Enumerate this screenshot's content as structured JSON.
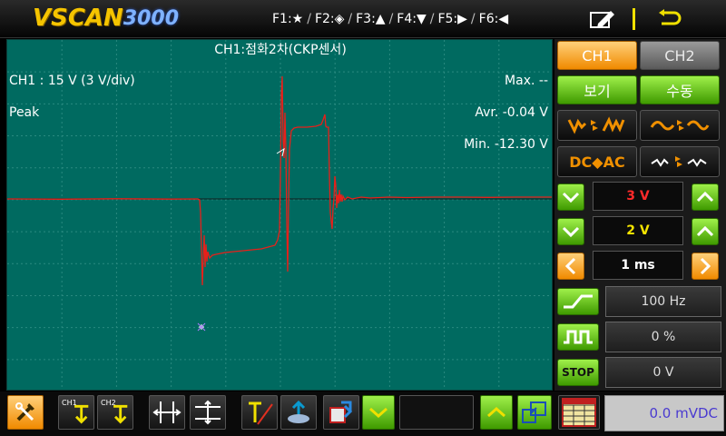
{
  "header": {
    "logo_part1": "VSCAN",
    "logo_part2": "3000",
    "fkeys": [
      "F1:★",
      "F2:◈",
      "F3:▲",
      "F4:▼",
      "F5:▶",
      "F6:◀"
    ]
  },
  "scope": {
    "title": "CH1:점화2차(CKP센서)",
    "scale_label": "CH1 : 15 V (3 V/div)",
    "mode_label": "Peak",
    "max_label": "Max. --",
    "avr_label": "Avr. -0.04 V",
    "min_label": "Min. -12.30 V",
    "trace_color": "#e8201a",
    "background_color": "#006a60"
  },
  "panel": {
    "ch1_label": "CH1",
    "ch2_label": "CH2",
    "view_label": "보기",
    "manual_label": "수동",
    "dc_ac_label": "DC◆AC",
    "volt_div_ch1": "3 V",
    "volt_div_ch2": "2 V",
    "time_div": "1 ms",
    "frequency": "100 Hz",
    "duty": "0 %",
    "stop_label": "STOP",
    "stop_value": "0 V"
  },
  "toolbar": {
    "ch1_label": "CH1",
    "ch2_label": "CH2",
    "readout": "0.0 mVDC"
  }
}
